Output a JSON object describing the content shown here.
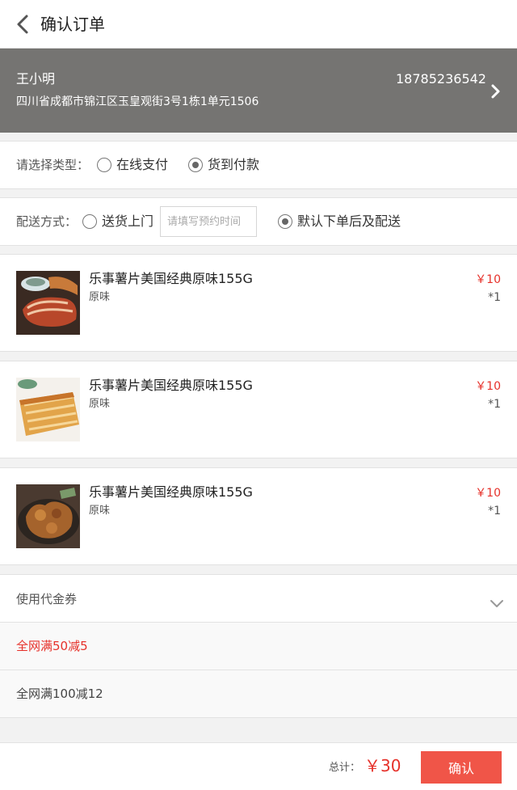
{
  "header": {
    "title": "确认订单",
    "back_icon": "chevron-left-icon"
  },
  "address": {
    "name": "王小明",
    "phone": "18785236542",
    "detail": "四川省成都市锦江区玉皇观街3号1栋1单元1506",
    "arrow_icon": "chevron-right-icon"
  },
  "payment": {
    "label": "请选择类型：",
    "options": [
      {
        "label": "在线支付",
        "selected": false
      },
      {
        "label": "货到付款",
        "selected": true
      }
    ]
  },
  "delivery": {
    "label": "配送方式：",
    "door_label": "送货上门",
    "door_selected": false,
    "time_placeholder": "请填写预约时间",
    "default_label": "默认下单后及配送",
    "default_selected": true
  },
  "products": [
    {
      "name": "乐事薯片美国经典原味155G",
      "spec": "原味",
      "price": "￥10",
      "qty": "*1"
    },
    {
      "name": "乐事薯片美国经典原味155G",
      "spec": "原味",
      "price": "￥10",
      "qty": "*1"
    },
    {
      "name": "乐事薯片美国经典原味155G",
      "spec": "原味",
      "price": "￥10",
      "qty": "*1"
    }
  ],
  "coupon": {
    "label": "使用代金券",
    "options": [
      {
        "label": "全网满50减5",
        "selected": true
      },
      {
        "label": "全网满100减12",
        "selected": false
      }
    ]
  },
  "footer": {
    "total_label": "总计：",
    "total_value": "￥30",
    "confirm_label": "确认"
  },
  "colors": {
    "accent": "#e6312a",
    "button": "#f05548",
    "address_bg": "#757472"
  }
}
